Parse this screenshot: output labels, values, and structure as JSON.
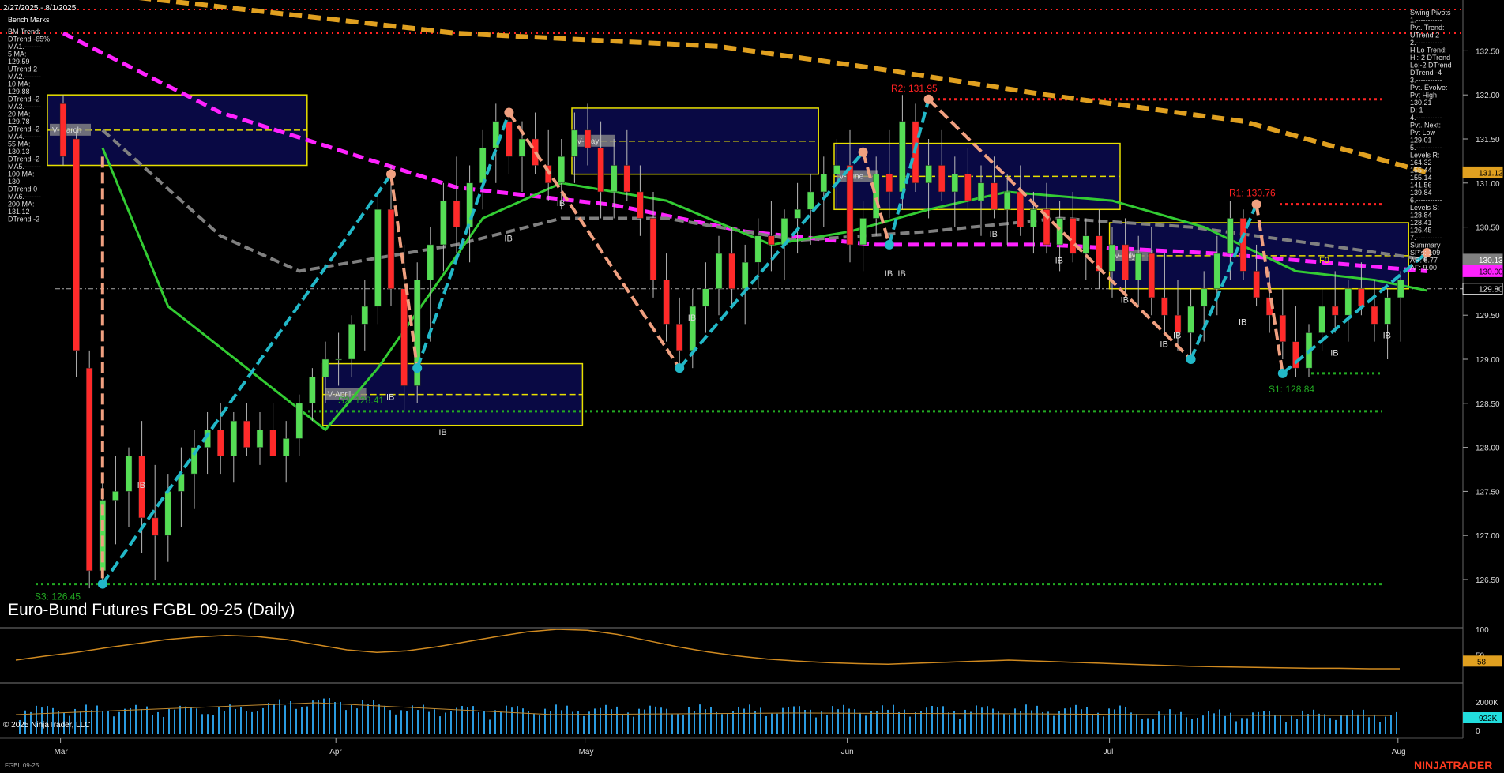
{
  "header": {
    "date_range": "2/27/2025 - 8/1/2025",
    "bench_marks": "Bench Marks"
  },
  "left_panel": [
    "BM Trend:",
    "DTrend -65%",
    "MA1.-------",
    "5 MA:",
    "129.59",
    "UTrend 2",
    "MA2.-------",
    "10 MA:",
    "129.88",
    "DTrend -2",
    "MA3.-------",
    "20 MA:",
    "129.78",
    "DTrend -2",
    "MA4.-------",
    "55 MA:",
    "130.13",
    "DTrend -2",
    "MA5.-------",
    "100 MA:",
    "130",
    "DTrend 0",
    "MA6.-------",
    "200 MA:",
    "131.12",
    "DTrend -2"
  ],
  "right_panel": [
    "Swing Pivots",
    "1.-----------",
    "Pvt. Trend:",
    "UTrend 2",
    "2.-----------",
    "HiLo Trend:",
    "Hi:-2 DTrend",
    "Lo:-2 DTrend",
    "DTrend -4",
    "3.-----------",
    "Pvt. Evolve:",
    "Pvt High",
    "130.21",
    "D: 1",
    "4.-----------",
    "Pvt. Next:",
    "Pvt Low",
    "129.01",
    "5.-----------",
    "Levels R:",
    "164.32",
    "155.44",
    "155.14",
    "141.56",
    "139.84",
    "6.-----------",
    "Levels S:",
    "128.84",
    "128.41",
    "126.45",
    "7.-----------",
    "Summary",
    "SP's: 109",
    "AR: 5.77",
    "AF: 9.00"
  ],
  "title": "Euro-Bund Futures FGBL 09-25 (Daily)",
  "copyright": "© 2025 NinjaTrader, LLC",
  "symbol_footer": "FGBL 09-25",
  "brand": "NINJATRADER",
  "colors": {
    "background": "#000000",
    "up_candle": "#55dd55",
    "down_candle": "#ff2a2a",
    "magenta": "#ff22ff",
    "orange_ma": "#e0a020",
    "green_ma": "#33cc33",
    "gray_ma": "#808080",
    "swing_up": "#22b8c8",
    "swing_down": "#f0a080",
    "box_fill": "#0a0a50",
    "box_border": "#e8e000"
  },
  "chart_data": {
    "type": "candlestick",
    "instrument": "Euro-Bund Futures FGBL 09-25",
    "timeframe": "Daily",
    "y_range": [
      126.2,
      132.75
    ],
    "y_ticks": [
      "132.50",
      "132.00",
      "131.50",
      "131.00",
      "130.50",
      "130.00",
      "129.50",
      "129.00",
      "128.50",
      "128.00",
      "127.50",
      "127.00",
      "126.50"
    ],
    "x_labels": [
      {
        "label": "Mar",
        "index": 1
      },
      {
        "label": "Apr",
        "index": 22
      },
      {
        "label": "May",
        "index": 41
      },
      {
        "label": "Jun",
        "index": 61
      },
      {
        "label": "Jul",
        "index": 81
      },
      {
        "label": "Aug",
        "index": 103
      }
    ],
    "ohlc": [
      [
        131.9,
        132.0,
        131.2,
        131.3
      ],
      [
        131.5,
        131.6,
        128.8,
        129.1
      ],
      [
        128.9,
        129.1,
        126.4,
        126.6
      ],
      [
        126.6,
        127.6,
        126.4,
        127.4
      ],
      [
        127.4,
        127.9,
        126.9,
        127.5
      ],
      [
        127.5,
        128.0,
        127.1,
        127.9
      ],
      [
        127.9,
        128.3,
        126.8,
        127.2
      ],
      [
        127.2,
        127.8,
        126.5,
        127.0
      ],
      [
        127.0,
        127.7,
        126.7,
        127.5
      ],
      [
        127.5,
        128.0,
        127.1,
        127.7
      ],
      [
        127.7,
        128.2,
        127.3,
        128.0
      ],
      [
        128.0,
        128.4,
        127.7,
        128.2
      ],
      [
        128.2,
        128.5,
        127.7,
        127.9
      ],
      [
        127.9,
        128.4,
        127.6,
        128.3
      ],
      [
        128.3,
        128.5,
        127.9,
        128.0
      ],
      [
        128.0,
        128.4,
        127.8,
        128.2
      ],
      [
        128.2,
        128.5,
        127.9,
        127.9
      ],
      [
        127.9,
        128.3,
        127.6,
        128.1
      ],
      [
        128.1,
        128.6,
        127.9,
        128.5
      ],
      [
        128.5,
        128.9,
        128.3,
        128.8
      ],
      [
        128.8,
        129.2,
        128.5,
        129.0
      ],
      [
        129.0,
        129.3,
        128.7,
        129.0
      ],
      [
        129.0,
        129.5,
        128.8,
        129.4
      ],
      [
        129.4,
        129.9,
        129.1,
        129.6
      ],
      [
        129.6,
        130.9,
        129.4,
        130.7
      ],
      [
        130.7,
        131.2,
        129.6,
        129.8
      ],
      [
        129.8,
        130.3,
        128.4,
        128.7
      ],
      [
        128.7,
        130.1,
        128.5,
        129.9
      ],
      [
        129.9,
        130.5,
        129.2,
        130.3
      ],
      [
        130.3,
        131.0,
        130.0,
        130.8
      ],
      [
        130.8,
        131.3,
        130.2,
        130.5
      ],
      [
        130.5,
        131.2,
        130.1,
        131.0
      ],
      [
        131.0,
        131.6,
        130.7,
        131.4
      ],
      [
        131.4,
        131.9,
        131.0,
        131.7
      ],
      [
        131.7,
        131.8,
        131.1,
        131.3
      ],
      [
        131.3,
        131.7,
        130.9,
        131.5
      ],
      [
        131.5,
        131.8,
        131.1,
        131.2
      ],
      [
        131.2,
        131.6,
        130.8,
        131.0
      ],
      [
        131.0,
        131.5,
        130.7,
        131.3
      ],
      [
        131.3,
        131.8,
        131.0,
        131.6
      ],
      [
        131.6,
        131.9,
        131.2,
        131.4
      ],
      [
        131.4,
        131.7,
        130.6,
        130.9
      ],
      [
        130.9,
        131.5,
        130.6,
        131.2
      ],
      [
        131.2,
        131.6,
        130.8,
        130.9
      ],
      [
        130.9,
        131.2,
        130.4,
        130.6
      ],
      [
        130.6,
        130.9,
        129.7,
        129.9
      ],
      [
        129.9,
        130.2,
        129.2,
        129.4
      ],
      [
        129.4,
        129.7,
        128.9,
        129.1
      ],
      [
        129.1,
        129.8,
        128.9,
        129.6
      ],
      [
        129.6,
        130.1,
        129.3,
        129.8
      ],
      [
        129.8,
        130.4,
        129.5,
        130.2
      ],
      [
        130.2,
        130.5,
        129.6,
        129.8
      ],
      [
        129.8,
        130.3,
        129.4,
        130.1
      ],
      [
        130.1,
        130.6,
        129.8,
        130.4
      ],
      [
        130.4,
        130.8,
        130.0,
        130.3
      ],
      [
        130.3,
        130.7,
        129.9,
        130.6
      ],
      [
        130.6,
        131.0,
        130.2,
        130.7
      ],
      [
        130.7,
        131.1,
        130.3,
        130.9
      ],
      [
        130.9,
        131.3,
        130.5,
        131.1
      ],
      [
        131.1,
        131.5,
        130.7,
        131.2
      ],
      [
        131.2,
        131.6,
        130.1,
        130.3
      ],
      [
        130.3,
        130.8,
        130.0,
        130.6
      ],
      [
        130.6,
        131.3,
        130.4,
        131.1
      ],
      [
        131.1,
        131.6,
        130.6,
        130.9
      ],
      [
        130.9,
        132.0,
        130.7,
        131.7
      ],
      [
        131.7,
        131.9,
        130.9,
        131.0
      ],
      [
        131.0,
        131.5,
        130.6,
        131.2
      ],
      [
        131.2,
        131.6,
        130.8,
        130.9
      ],
      [
        130.9,
        131.3,
        130.5,
        131.1
      ],
      [
        131.1,
        131.4,
        130.7,
        130.8
      ],
      [
        130.8,
        131.2,
        130.4,
        131.0
      ],
      [
        131.0,
        131.3,
        130.6,
        130.7
      ],
      [
        130.7,
        131.1,
        130.3,
        130.9
      ],
      [
        130.9,
        131.2,
        130.4,
        130.5
      ],
      [
        130.5,
        130.9,
        130.2,
        130.7
      ],
      [
        130.7,
        131.0,
        130.2,
        130.3
      ],
      [
        130.3,
        130.8,
        130.0,
        130.6
      ],
      [
        130.6,
        130.9,
        130.1,
        130.2
      ],
      [
        130.2,
        130.6,
        129.9,
        130.4
      ],
      [
        130.4,
        130.7,
        129.8,
        130.0
      ],
      [
        130.0,
        130.5,
        129.7,
        130.3
      ],
      [
        130.3,
        130.6,
        129.7,
        129.9
      ],
      [
        129.9,
        130.4,
        129.6,
        130.2
      ],
      [
        130.2,
        130.5,
        129.5,
        129.7
      ],
      [
        129.7,
        130.2,
        129.3,
        129.5
      ],
      [
        129.5,
        129.9,
        129.1,
        129.3
      ],
      [
        129.3,
        129.8,
        129.0,
        129.6
      ],
      [
        129.6,
        130.0,
        129.2,
        129.8
      ],
      [
        129.8,
        130.4,
        129.5,
        130.2
      ],
      [
        130.2,
        130.8,
        129.9,
        130.6
      ],
      [
        130.6,
        130.7,
        129.9,
        130.0
      ],
      [
        130.0,
        130.3,
        129.6,
        129.7
      ],
      [
        129.7,
        130.0,
        129.3,
        129.5
      ],
      [
        129.5,
        129.8,
        129.0,
        129.2
      ],
      [
        129.2,
        129.6,
        128.8,
        128.9
      ],
      [
        128.9,
        129.4,
        128.8,
        129.3
      ],
      [
        129.3,
        129.8,
        129.1,
        129.6
      ],
      [
        129.6,
        130.0,
        129.3,
        129.5
      ],
      [
        129.5,
        129.9,
        129.2,
        129.8
      ],
      [
        129.8,
        130.1,
        129.5,
        129.6
      ],
      [
        129.6,
        129.9,
        129.2,
        129.4
      ],
      [
        129.4,
        129.8,
        129.0,
        129.7
      ],
      [
        129.7,
        130.0,
        129.2,
        129.9
      ]
    ],
    "moving_averages": [
      {
        "name": "200 MA",
        "color": "#e0a020",
        "points": [
          [
            0,
            133.2
          ],
          [
            30,
            132.7
          ],
          [
            50,
            132.55
          ],
          [
            62,
            132.3
          ],
          [
            75,
            132.0
          ],
          [
            90,
            131.7
          ],
          [
            104,
            131.12
          ]
        ]
      },
      {
        "name": "100 MA",
        "color": "#ff22ff",
        "points": [
          [
            0,
            132.7
          ],
          [
            12,
            131.8
          ],
          [
            30,
            130.95
          ],
          [
            42,
            130.75
          ],
          [
            52,
            130.45
          ],
          [
            62,
            130.3
          ],
          [
            75,
            130.3
          ],
          [
            88,
            130.2
          ],
          [
            96,
            130.1
          ],
          [
            104,
            130.0
          ]
        ]
      },
      {
        "name": "55 MA",
        "color": "#808080",
        "points": [
          [
            3,
            131.6
          ],
          [
            12,
            130.4
          ],
          [
            18,
            130.0
          ],
          [
            30,
            130.3
          ],
          [
            38,
            130.6
          ],
          [
            46,
            130.6
          ],
          [
            56,
            130.35
          ],
          [
            66,
            130.45
          ],
          [
            76,
            130.6
          ],
          [
            86,
            130.5
          ],
          [
            96,
            130.3
          ],
          [
            104,
            130.13
          ]
        ]
      },
      {
        "name": "20 MA",
        "color": "#33cc33",
        "points": [
          [
            3,
            131.4
          ],
          [
            8,
            129.6
          ],
          [
            14,
            128.9
          ],
          [
            20,
            128.2
          ],
          [
            24,
            128.9
          ],
          [
            32,
            130.6
          ],
          [
            38,
            131.0
          ],
          [
            46,
            130.8
          ],
          [
            54,
            130.3
          ],
          [
            60,
            130.45
          ],
          [
            66,
            130.7
          ],
          [
            72,
            130.9
          ],
          [
            80,
            130.8
          ],
          [
            87,
            130.5
          ],
          [
            94,
            130.0
          ],
          [
            100,
            129.9
          ],
          [
            104,
            129.78
          ]
        ]
      }
    ],
    "swing_legs": [
      {
        "dir": "down",
        "from": [
          3,
          131.3
        ],
        "to": [
          3,
          126.45
        ]
      },
      {
        "dir": "up",
        "from": [
          3,
          126.45
        ],
        "to": [
          25,
          131.1
        ]
      },
      {
        "dir": "down",
        "from": [
          25,
          131.1
        ],
        "to": [
          27,
          128.9
        ]
      },
      {
        "dir": "up",
        "from": [
          27,
          128.9
        ],
        "to": [
          34,
          131.8
        ]
      },
      {
        "dir": "down",
        "from": [
          34,
          131.8
        ],
        "to": [
          47,
          128.9
        ]
      },
      {
        "dir": "up",
        "from": [
          47,
          128.9
        ],
        "to": [
          61,
          131.35
        ]
      },
      {
        "dir": "down",
        "from": [
          61,
          131.35
        ],
        "to": [
          63,
          130.3
        ]
      },
      {
        "dir": "up",
        "from": [
          63,
          130.3
        ],
        "to": [
          66,
          131.95
        ]
      },
      {
        "dir": "down",
        "from": [
          66,
          131.95
        ],
        "to": [
          86,
          129.0
        ]
      },
      {
        "dir": "up",
        "from": [
          86,
          129.0
        ],
        "to": [
          91,
          130.76
        ]
      },
      {
        "dir": "down",
        "from": [
          91,
          130.76
        ],
        "to": [
          93,
          128.84
        ]
      },
      {
        "dir": "up",
        "from": [
          93,
          128.84
        ],
        "to": [
          104,
          130.21
        ]
      }
    ],
    "levels": [
      {
        "label": "R2: 131.95",
        "value": 131.95,
        "color": "#ff2222"
      },
      {
        "label": "R1: 130.76",
        "value": 130.76,
        "color": "#ff2222"
      },
      {
        "label": "S1: 128.84",
        "value": 128.84,
        "color": "#22aa22"
      },
      {
        "label": "S2: 128.41",
        "value": 128.41,
        "color": "#22aa22"
      },
      {
        "label": "S3: 126.45",
        "value": 126.45,
        "color": "#22aa22"
      }
    ],
    "value_boxes": [
      {
        "label": "V-March",
        "x0": 0,
        "x1": 18,
        "top": 132.0,
        "bottom": 131.2
      },
      {
        "label": "V-April",
        "x0": 21,
        "x1": 39,
        "top": 128.95,
        "bottom": 128.25
      },
      {
        "label": "V-May",
        "x0": 40,
        "x1": 57,
        "top": 131.85,
        "bottom": 131.1
      },
      {
        "label": "V-June",
        "x0": 60,
        "x1": 80,
        "top": 131.45,
        "bottom": 130.7
      },
      {
        "label": "V-July",
        "x0": 81,
        "x1": 102,
        "top": 130.55,
        "bottom": 129.8
      }
    ],
    "ib_markers": [
      [
        6,
        127.7
      ],
      [
        25,
        128.7
      ],
      [
        29,
        128.3
      ],
      [
        34,
        130.5
      ],
      [
        38,
        130.9
      ],
      [
        48,
        129.6
      ],
      [
        63,
        130.1
      ],
      [
        64,
        130.1
      ],
      [
        71,
        130.55
      ],
      [
        76,
        130.25
      ],
      [
        81,
        129.8
      ],
      [
        84,
        129.3
      ],
      [
        85,
        129.4
      ],
      [
        90,
        129.55
      ],
      [
        97,
        129.2
      ],
      [
        101,
        129.4
      ]
    ],
    "price_labels": [
      {
        "value": "132.50",
        "y": 132.5
      },
      {
        "value": "132.00",
        "y": 132.0
      },
      {
        "value": "131.50",
        "y": 131.5
      },
      {
        "value": "131.12",
        "y": 131.12,
        "boxed": true,
        "bg": "#e0a020",
        "fg": "#000"
      },
      {
        "value": "131.00",
        "y": 131.0
      },
      {
        "value": "130.50",
        "y": 130.5
      },
      {
        "value": "130.13",
        "y": 130.13,
        "boxed": true,
        "bg": "#808080",
        "fg": "#fff"
      },
      {
        "value": "130.00",
        "y": 130.0,
        "boxed": true,
        "bg": "#ff22ff",
        "fg": "#000"
      },
      {
        "value": "129.80",
        "y": 129.8,
        "boxed": true,
        "bg": "#000",
        "fg": "#fff",
        "border": "#fff"
      },
      {
        "value": "129.50",
        "y": 129.5
      },
      {
        "value": "129.00",
        "y": 129.0
      },
      {
        "value": "128.50",
        "y": 128.5
      },
      {
        "value": "128.00",
        "y": 128.0
      },
      {
        "value": "127.50",
        "y": 127.5
      },
      {
        "value": "127.00",
        "y": 127.0
      },
      {
        "value": "126.50",
        "y": 126.5
      }
    ],
    "f0_label": "F0",
    "oscillator": {
      "ticks": [
        "100",
        "50"
      ],
      "current": "58",
      "values": [
        40,
        48,
        55,
        64,
        72,
        80,
        85,
        88,
        86,
        80,
        70,
        60,
        55,
        58,
        66,
        76,
        86,
        95,
        100,
        98,
        90,
        78,
        66,
        56,
        48,
        42,
        38,
        35,
        33,
        32,
        34,
        36,
        38,
        40,
        38,
        36,
        34,
        32,
        30,
        28,
        27,
        26,
        25,
        24,
        24,
        23,
        23
      ]
    },
    "volume": {
      "ticks": [
        "2000K",
        "0"
      ],
      "current": "922K"
    }
  }
}
